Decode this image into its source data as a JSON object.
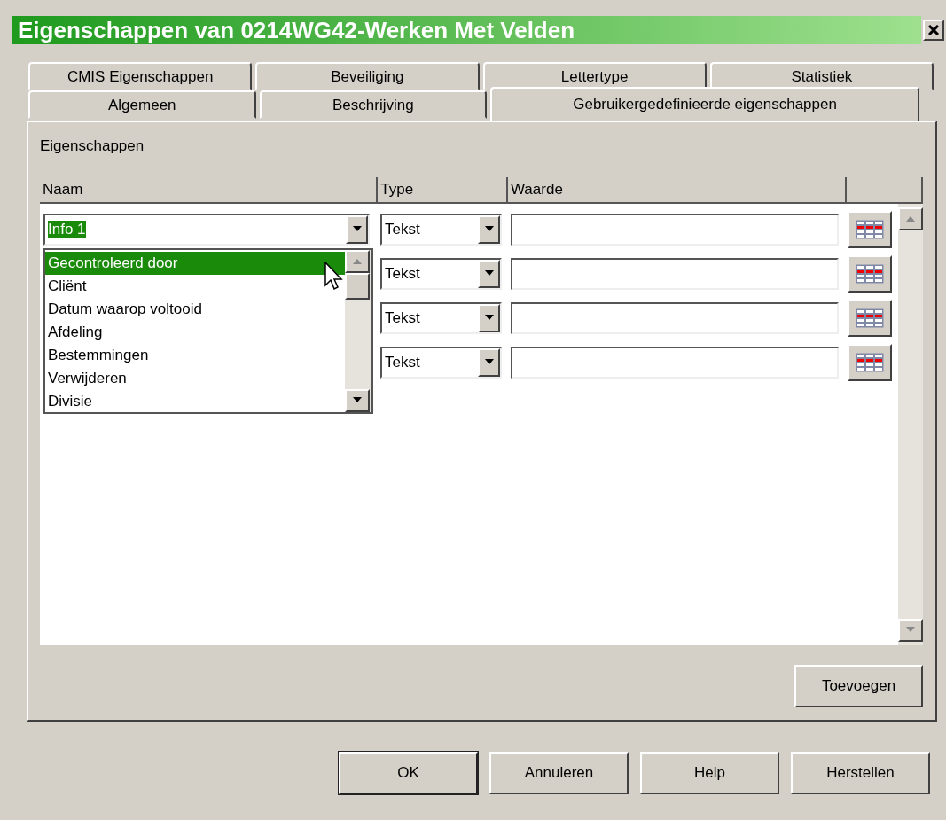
{
  "window": {
    "title": "Eigenschappen van 0214WG42-Werken Met Velden"
  },
  "tab_rows": [
    [
      {
        "label": "CMIS Eigenschappen",
        "selected": false
      },
      {
        "label": "Beveiliging",
        "selected": false
      },
      {
        "label": "Lettertype",
        "selected": false
      },
      {
        "label": "Statistiek",
        "selected": false
      }
    ],
    [
      {
        "label": "Algemeen",
        "selected": false
      },
      {
        "label": "Beschrijving",
        "selected": false
      },
      {
        "label": "Gebruikergedefinieerde eigenschappen",
        "selected": true
      }
    ]
  ],
  "section_label": "Eigenschappen",
  "table": {
    "columns": [
      "Naam",
      "Type",
      "Waarde"
    ],
    "rows": [
      {
        "name": "Info 1",
        "name_highlighted": true,
        "type": "Tekst"
      },
      {
        "type": "Tekst"
      },
      {
        "type": "Tekst"
      },
      {
        "type": "Tekst"
      }
    ]
  },
  "name_dropdown": {
    "items": [
      {
        "label": "Gecontroleerd door",
        "selected": true
      },
      {
        "label": "Cliënt",
        "selected": false
      },
      {
        "label": "Datum waarop voltooid",
        "selected": false
      },
      {
        "label": "Afdeling",
        "selected": false
      },
      {
        "label": "Bestemmingen",
        "selected": false
      },
      {
        "label": "Verwijderen",
        "selected": false
      },
      {
        "label": "Divisie",
        "selected": false
      }
    ]
  },
  "add_button": "Toevoegen",
  "footer_buttons": [
    {
      "label": "OK",
      "default": true
    },
    {
      "label": "Annuleren",
      "default": false
    },
    {
      "label": "Help",
      "default": false
    },
    {
      "label": "Herstellen",
      "default": false
    }
  ]
}
